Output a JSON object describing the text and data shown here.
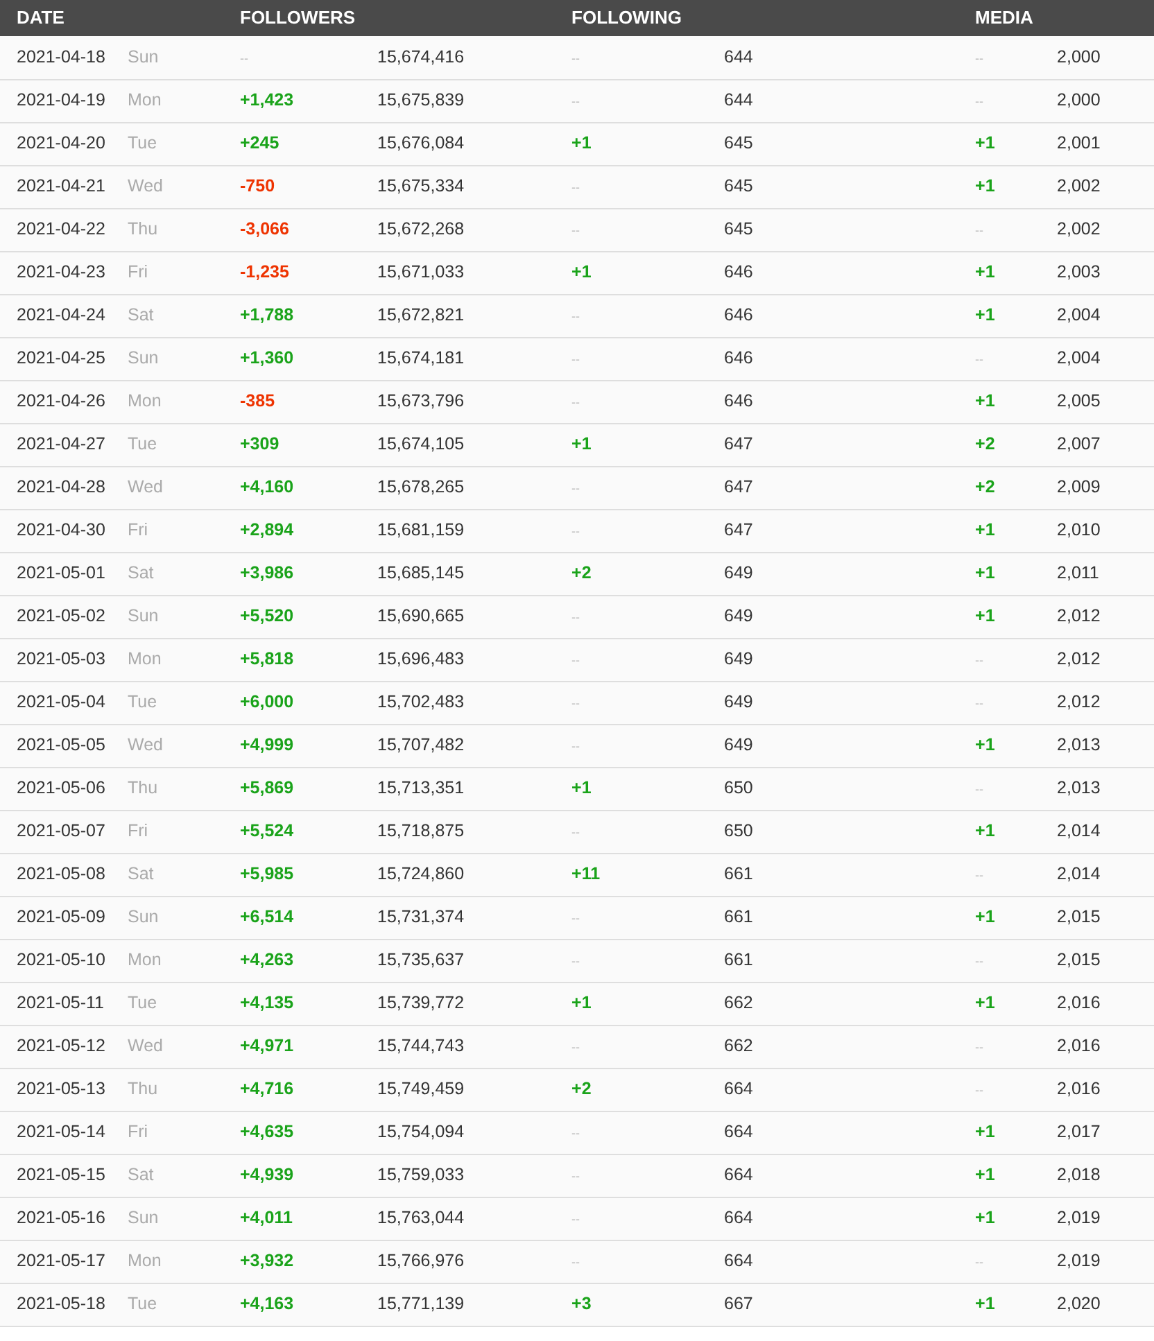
{
  "columns": [
    "DATE",
    "FOLLOWERS",
    "FOLLOWING",
    "MEDIA"
  ],
  "rows": [
    {
      "date": "2021-04-18",
      "day": "Sun",
      "followers": {
        "change": "--",
        "kind": "none",
        "total": "15,674,416"
      },
      "following": {
        "change": "--",
        "kind": "none",
        "total": "644"
      },
      "media": {
        "change": "--",
        "kind": "none",
        "total": "2,000"
      }
    },
    {
      "date": "2021-04-19",
      "day": "Mon",
      "followers": {
        "change": "+1,423",
        "kind": "up",
        "total": "15,675,839"
      },
      "following": {
        "change": "--",
        "kind": "none",
        "total": "644"
      },
      "media": {
        "change": "--",
        "kind": "none",
        "total": "2,000"
      }
    },
    {
      "date": "2021-04-20",
      "day": "Tue",
      "followers": {
        "change": "+245",
        "kind": "up",
        "total": "15,676,084"
      },
      "following": {
        "change": "+1",
        "kind": "up",
        "total": "645"
      },
      "media": {
        "change": "+1",
        "kind": "up",
        "total": "2,001"
      }
    },
    {
      "date": "2021-04-21",
      "day": "Wed",
      "followers": {
        "change": "-750",
        "kind": "down",
        "total": "15,675,334"
      },
      "following": {
        "change": "--",
        "kind": "none",
        "total": "645"
      },
      "media": {
        "change": "+1",
        "kind": "up",
        "total": "2,002"
      }
    },
    {
      "date": "2021-04-22",
      "day": "Thu",
      "followers": {
        "change": "-3,066",
        "kind": "down",
        "total": "15,672,268"
      },
      "following": {
        "change": "--",
        "kind": "none",
        "total": "645"
      },
      "media": {
        "change": "--",
        "kind": "none",
        "total": "2,002"
      }
    },
    {
      "date": "2021-04-23",
      "day": "Fri",
      "followers": {
        "change": "-1,235",
        "kind": "down",
        "total": "15,671,033"
      },
      "following": {
        "change": "+1",
        "kind": "up",
        "total": "646"
      },
      "media": {
        "change": "+1",
        "kind": "up",
        "total": "2,003"
      }
    },
    {
      "date": "2021-04-24",
      "day": "Sat",
      "followers": {
        "change": "+1,788",
        "kind": "up",
        "total": "15,672,821"
      },
      "following": {
        "change": "--",
        "kind": "none",
        "total": "646"
      },
      "media": {
        "change": "+1",
        "kind": "up",
        "total": "2,004"
      }
    },
    {
      "date": "2021-04-25",
      "day": "Sun",
      "followers": {
        "change": "+1,360",
        "kind": "up",
        "total": "15,674,181"
      },
      "following": {
        "change": "--",
        "kind": "none",
        "total": "646"
      },
      "media": {
        "change": "--",
        "kind": "none",
        "total": "2,004"
      }
    },
    {
      "date": "2021-04-26",
      "day": "Mon",
      "followers": {
        "change": "-385",
        "kind": "down",
        "total": "15,673,796"
      },
      "following": {
        "change": "--",
        "kind": "none",
        "total": "646"
      },
      "media": {
        "change": "+1",
        "kind": "up",
        "total": "2,005"
      }
    },
    {
      "date": "2021-04-27",
      "day": "Tue",
      "followers": {
        "change": "+309",
        "kind": "up",
        "total": "15,674,105"
      },
      "following": {
        "change": "+1",
        "kind": "up",
        "total": "647"
      },
      "media": {
        "change": "+2",
        "kind": "up",
        "total": "2,007"
      }
    },
    {
      "date": "2021-04-28",
      "day": "Wed",
      "followers": {
        "change": "+4,160",
        "kind": "up",
        "total": "15,678,265"
      },
      "following": {
        "change": "--",
        "kind": "none",
        "total": "647"
      },
      "media": {
        "change": "+2",
        "kind": "up",
        "total": "2,009"
      }
    },
    {
      "date": "2021-04-30",
      "day": "Fri",
      "followers": {
        "change": "+2,894",
        "kind": "up",
        "total": "15,681,159"
      },
      "following": {
        "change": "--",
        "kind": "none",
        "total": "647"
      },
      "media": {
        "change": "+1",
        "kind": "up",
        "total": "2,010"
      }
    },
    {
      "date": "2021-05-01",
      "day": "Sat",
      "followers": {
        "change": "+3,986",
        "kind": "up",
        "total": "15,685,145"
      },
      "following": {
        "change": "+2",
        "kind": "up",
        "total": "649"
      },
      "media": {
        "change": "+1",
        "kind": "up",
        "total": "2,011"
      }
    },
    {
      "date": "2021-05-02",
      "day": "Sun",
      "followers": {
        "change": "+5,520",
        "kind": "up",
        "total": "15,690,665"
      },
      "following": {
        "change": "--",
        "kind": "none",
        "total": "649"
      },
      "media": {
        "change": "+1",
        "kind": "up",
        "total": "2,012"
      }
    },
    {
      "date": "2021-05-03",
      "day": "Mon",
      "followers": {
        "change": "+5,818",
        "kind": "up",
        "total": "15,696,483"
      },
      "following": {
        "change": "--",
        "kind": "none",
        "total": "649"
      },
      "media": {
        "change": "--",
        "kind": "none",
        "total": "2,012"
      }
    },
    {
      "date": "2021-05-04",
      "day": "Tue",
      "followers": {
        "change": "+6,000",
        "kind": "up",
        "total": "15,702,483"
      },
      "following": {
        "change": "--",
        "kind": "none",
        "total": "649"
      },
      "media": {
        "change": "--",
        "kind": "none",
        "total": "2,012"
      }
    },
    {
      "date": "2021-05-05",
      "day": "Wed",
      "followers": {
        "change": "+4,999",
        "kind": "up",
        "total": "15,707,482"
      },
      "following": {
        "change": "--",
        "kind": "none",
        "total": "649"
      },
      "media": {
        "change": "+1",
        "kind": "up",
        "total": "2,013"
      }
    },
    {
      "date": "2021-05-06",
      "day": "Thu",
      "followers": {
        "change": "+5,869",
        "kind": "up",
        "total": "15,713,351"
      },
      "following": {
        "change": "+1",
        "kind": "up",
        "total": "650"
      },
      "media": {
        "change": "--",
        "kind": "none",
        "total": "2,013"
      }
    },
    {
      "date": "2021-05-07",
      "day": "Fri",
      "followers": {
        "change": "+5,524",
        "kind": "up",
        "total": "15,718,875"
      },
      "following": {
        "change": "--",
        "kind": "none",
        "total": "650"
      },
      "media": {
        "change": "+1",
        "kind": "up",
        "total": "2,014"
      }
    },
    {
      "date": "2021-05-08",
      "day": "Sat",
      "followers": {
        "change": "+5,985",
        "kind": "up",
        "total": "15,724,860"
      },
      "following": {
        "change": "+11",
        "kind": "up",
        "total": "661"
      },
      "media": {
        "change": "--",
        "kind": "none",
        "total": "2,014"
      }
    },
    {
      "date": "2021-05-09",
      "day": "Sun",
      "followers": {
        "change": "+6,514",
        "kind": "up",
        "total": "15,731,374"
      },
      "following": {
        "change": "--",
        "kind": "none",
        "total": "661"
      },
      "media": {
        "change": "+1",
        "kind": "up",
        "total": "2,015"
      }
    },
    {
      "date": "2021-05-10",
      "day": "Mon",
      "followers": {
        "change": "+4,263",
        "kind": "up",
        "total": "15,735,637"
      },
      "following": {
        "change": "--",
        "kind": "none",
        "total": "661"
      },
      "media": {
        "change": "--",
        "kind": "none",
        "total": "2,015"
      }
    },
    {
      "date": "2021-05-11",
      "day": "Tue",
      "followers": {
        "change": "+4,135",
        "kind": "up",
        "total": "15,739,772"
      },
      "following": {
        "change": "+1",
        "kind": "up",
        "total": "662"
      },
      "media": {
        "change": "+1",
        "kind": "up",
        "total": "2,016"
      }
    },
    {
      "date": "2021-05-12",
      "day": "Wed",
      "followers": {
        "change": "+4,971",
        "kind": "up",
        "total": "15,744,743"
      },
      "following": {
        "change": "--",
        "kind": "none",
        "total": "662"
      },
      "media": {
        "change": "--",
        "kind": "none",
        "total": "2,016"
      }
    },
    {
      "date": "2021-05-13",
      "day": "Thu",
      "followers": {
        "change": "+4,716",
        "kind": "up",
        "total": "15,749,459"
      },
      "following": {
        "change": "+2",
        "kind": "up",
        "total": "664"
      },
      "media": {
        "change": "--",
        "kind": "none",
        "total": "2,016"
      }
    },
    {
      "date": "2021-05-14",
      "day": "Fri",
      "followers": {
        "change": "+4,635",
        "kind": "up",
        "total": "15,754,094"
      },
      "following": {
        "change": "--",
        "kind": "none",
        "total": "664"
      },
      "media": {
        "change": "+1",
        "kind": "up",
        "total": "2,017"
      }
    },
    {
      "date": "2021-05-15",
      "day": "Sat",
      "followers": {
        "change": "+4,939",
        "kind": "up",
        "total": "15,759,033"
      },
      "following": {
        "change": "--",
        "kind": "none",
        "total": "664"
      },
      "media": {
        "change": "+1",
        "kind": "up",
        "total": "2,018"
      }
    },
    {
      "date": "2021-05-16",
      "day": "Sun",
      "followers": {
        "change": "+4,011",
        "kind": "up",
        "total": "15,763,044"
      },
      "following": {
        "change": "--",
        "kind": "none",
        "total": "664"
      },
      "media": {
        "change": "+1",
        "kind": "up",
        "total": "2,019"
      }
    },
    {
      "date": "2021-05-17",
      "day": "Mon",
      "followers": {
        "change": "+3,932",
        "kind": "up",
        "total": "15,766,976"
      },
      "following": {
        "change": "--",
        "kind": "none",
        "total": "664"
      },
      "media": {
        "change": "--",
        "kind": "none",
        "total": "2,019"
      }
    },
    {
      "date": "2021-05-18",
      "day": "Tue",
      "followers": {
        "change": "+4,163",
        "kind": "up",
        "total": "15,771,139"
      },
      "following": {
        "change": "+3",
        "kind": "up",
        "total": "667"
      },
      "media": {
        "change": "+1",
        "kind": "up",
        "total": "2,020"
      }
    }
  ]
}
